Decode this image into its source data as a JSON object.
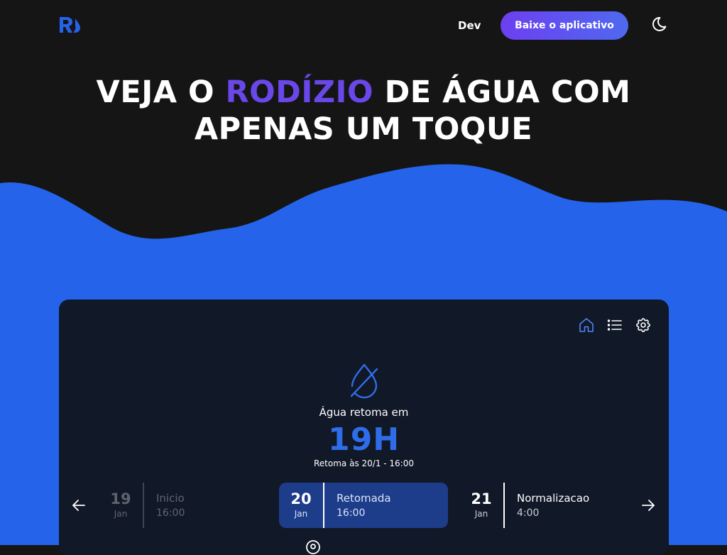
{
  "header": {
    "logo_text": "R",
    "dev_link": "Dev",
    "download_button": "Baixe o aplicativo",
    "theme_icon": "moon-icon"
  },
  "hero": {
    "line1_before": "VEJA O",
    "line1_accent": "RODÍZIO",
    "line1_after": "DE ÁGUA COM",
    "line2": "APENAS UM TOQUE"
  },
  "app": {
    "nav_icons": [
      "home-icon",
      "list-icon",
      "settings-icon"
    ],
    "status_icon": "water-off-icon",
    "status_label": "Água retoma em",
    "status_time": "19H",
    "status_sub": "Retoma às 20/1 - 16:00",
    "timeline": [
      {
        "day": "19",
        "month": "Jan",
        "title": "Inicio",
        "time": "16:00",
        "state": "past"
      },
      {
        "day": "20",
        "month": "Jan",
        "title": "Retomada",
        "time": "16:00",
        "state": "active"
      },
      {
        "day": "21",
        "month": "Jan",
        "title": "Normalizacao",
        "time": "4:00",
        "state": "future"
      }
    ],
    "location_icon": "location-pin-icon"
  },
  "colors": {
    "background": "#151515",
    "wave": "#2563eb",
    "accent": "#6a47e8",
    "card": "#111827",
    "status_blue": "#2f6de8",
    "active_day": "#1d3c8a"
  }
}
